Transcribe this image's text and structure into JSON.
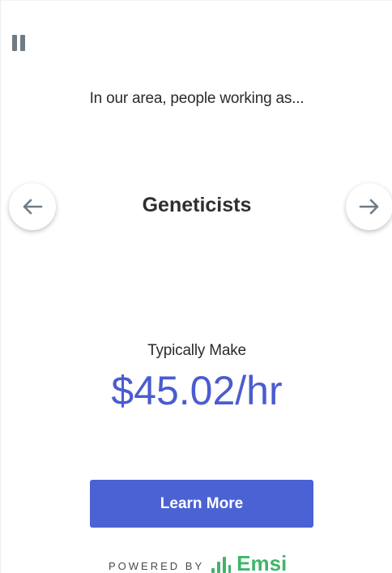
{
  "controls": {
    "pause_icon": "pause-icon",
    "prev_icon": "arrow-left-icon",
    "next_icon": "arrow-right-icon"
  },
  "card": {
    "intro": "In our area, people working as...",
    "occupation": "Geneticists",
    "make_label": "Typically Make",
    "wage": "$45.02/hr"
  },
  "cta": {
    "label": "Learn More"
  },
  "footer": {
    "powered_by": "POWERED BY",
    "brand": "Emsi"
  },
  "colors": {
    "wage": "#4a5cd0",
    "button": "#4a62d3",
    "brand": "#3fb56a",
    "icon": "#6f7c86"
  }
}
